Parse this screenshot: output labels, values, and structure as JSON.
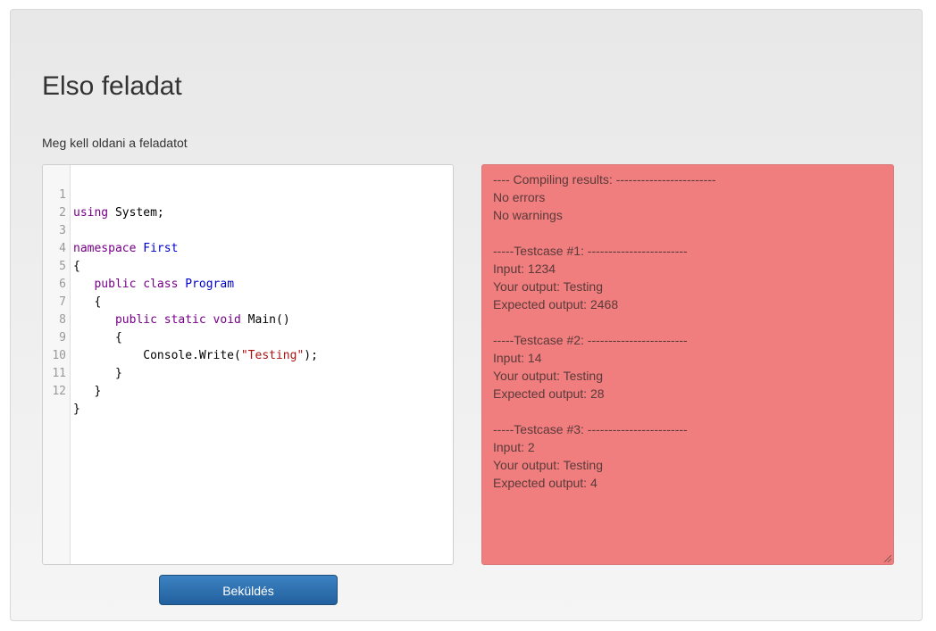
{
  "page": {
    "title": "Elso feladat",
    "description": "Meg kell oldani a feladatot",
    "submit_label": "Beküldés"
  },
  "editor": {
    "line_numbers": [
      "1",
      "2",
      "3",
      "4",
      "5",
      "6",
      "7",
      "8",
      "9",
      "10",
      "11",
      "12"
    ],
    "code": {
      "l1_kw": "using",
      "l1_rest": " System;",
      "l3_kw": "namespace",
      "l3_space": " ",
      "l3_name": "First",
      "l4": "{",
      "l5_indent": "   ",
      "l5_kw": "public class",
      "l5_space": " ",
      "l5_name": "Program",
      "l6": "   {",
      "l7_indent": "      ",
      "l7_kw": "public static void",
      "l7_rest": " Main()",
      "l8": "      {",
      "l9_pre": "          Console.Write(",
      "l9_str": "\"Testing\"",
      "l9_post": ");",
      "l10": "      }",
      "l11": "   }",
      "l12": "}"
    }
  },
  "output": {
    "lines": [
      "---- Compiling results: ------------------------",
      "No errors",
      "No warnings",
      "",
      "-----Testcase #1: ------------------------",
      "Input: 1234",
      "Your output: Testing",
      "Expected output: 2468",
      "",
      "-----Testcase #2: ------------------------",
      "Input: 14",
      "Your output: Testing",
      "Expected output: 28",
      "",
      "-----Testcase #3: ------------------------",
      "Input: 2",
      "Your output: Testing",
      "Expected output: 4"
    ],
    "background_color": "#f07e7e"
  }
}
